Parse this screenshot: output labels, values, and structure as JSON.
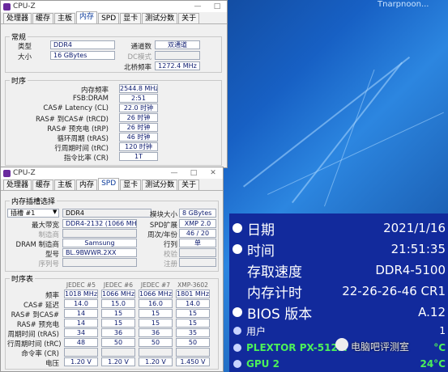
{
  "desktop": {
    "title_fragment": "Tnarpnoon..."
  },
  "window1": {
    "title": "CPU-Z",
    "controls": [
      "—",
      "□"
    ],
    "tabs": [
      "处理器",
      "缓存",
      "主板",
      "内存",
      "SPD",
      "显卡",
      "测试分数",
      "关于"
    ],
    "active_tab": 3,
    "general": {
      "heading": "常规",
      "type_label": "类型",
      "type_value": "DDR4",
      "size_label": "大小",
      "size_value": "16 GBytes",
      "channel_label": "通道数",
      "channel_value": "双通道",
      "dc_label": "DC模式",
      "dc_value": "",
      "nb_label": "北桥频率",
      "nb_value": "1272.4 MHz"
    },
    "timings": {
      "heading": "时序",
      "rows": [
        {
          "label": "内存频率",
          "value": "2544.8 MHz"
        },
        {
          "label": "FSB:DRAM",
          "value": "2:51"
        },
        {
          "label": "CAS# Latency (CL)",
          "value": "22.0 时钟"
        },
        {
          "label": "RAS# 到CAS# (tRCD)",
          "value": "26 时钟"
        },
        {
          "label": "RAS# 预充电 (tRP)",
          "value": "26 时钟"
        },
        {
          "label": "循环周期 (tRAS)",
          "value": "46 时钟"
        },
        {
          "label": "行周期时间 (tRC)",
          "value": "120 时钟"
        },
        {
          "label": "指令比率 (CR)",
          "value": "1T"
        }
      ]
    }
  },
  "window2": {
    "title": "CPU-Z",
    "controls": [
      "—",
      "□",
      "✕"
    ],
    "tabs": [
      "处理器",
      "缓存",
      "主板",
      "内存",
      "SPD",
      "显卡",
      "测试分数",
      "关于"
    ],
    "active_tab": 4,
    "slot": {
      "heading": "内存插槽选择",
      "slot_select": "插槽 #1",
      "module_type": "DDR4",
      "max_bw_label": "最大带宽",
      "max_bw_value": "DDR4-2132 (1066 MHz)",
      "manuf_label": "制造商",
      "manuf_value": "",
      "dram_label": "DRAM 制造商",
      "dram_value": "Samsung",
      "part_label": "型号",
      "part_value": "BL.9BWWR.2XX",
      "serial_label": "序列号",
      "serial_value": "",
      "size_label": "模块大小",
      "size_value": "8 GBytes",
      "spd_ext_label": "SPD扩展",
      "spd_ext_value": "XMP 2.0",
      "week_label": "周次/年份",
      "week_value": "46 / 20",
      "rank_label": "行列",
      "rank_value": "单",
      "correction_label": "校验",
      "correction_value": "",
      "registered_label": "注册",
      "registered_value": ""
    },
    "timing_table": {
      "heading": "时序表",
      "columns": [
        "JEDEC #5",
        "JEDEC #6",
        "JEDEC #7",
        "XMP-3602"
      ],
      "rows": [
        {
          "label": "频率",
          "values": [
            "1018 MHz",
            "1066 MHz",
            "1066 MHz",
            "1801 MHz"
          ]
        },
        {
          "label": "CAS# 延迟",
          "values": [
            "14.0",
            "15.0",
            "16.0",
            "14.0"
          ]
        },
        {
          "label": "RAS# 到CAS#",
          "values": [
            "14",
            "15",
            "15",
            "15"
          ]
        },
        {
          "label": "RAS# 预充电",
          "values": [
            "14",
            "15",
            "15",
            "15"
          ]
        },
        {
          "label": "周期时间 (tRAS)",
          "values": [
            "34",
            "36",
            "36",
            "35"
          ]
        },
        {
          "label": "行周期时间 (tRC)",
          "values": [
            "48",
            "50",
            "50",
            "50"
          ]
        },
        {
          "label": "命令率 (CR)",
          "values": [
            "",
            "",
            "",
            ""
          ]
        },
        {
          "label": "电压",
          "values": [
            "1.20 V",
            "1.20 V",
            "1.20 V",
            "1.450 V"
          ]
        }
      ]
    }
  },
  "aida": {
    "rows": [
      {
        "label": "日期",
        "value": "2021/1/16"
      },
      {
        "label": "时间",
        "value": "21:51:35"
      },
      {
        "label": "存取速度",
        "value": "DDR4-5100"
      },
      {
        "label": "内存计时",
        "value": "22-26-26-46 CR1"
      },
      {
        "label": "BIOS 版本",
        "value": "A.12"
      }
    ],
    "small_rows": [
      {
        "label": "用户",
        "value": "1"
      },
      {
        "label": "PLEXTOR PX-512M",
        "value": "°C"
      },
      {
        "label": "GPU 2",
        "value": "24°C"
      }
    ],
    "watermark": "电脑吧评测室"
  }
}
